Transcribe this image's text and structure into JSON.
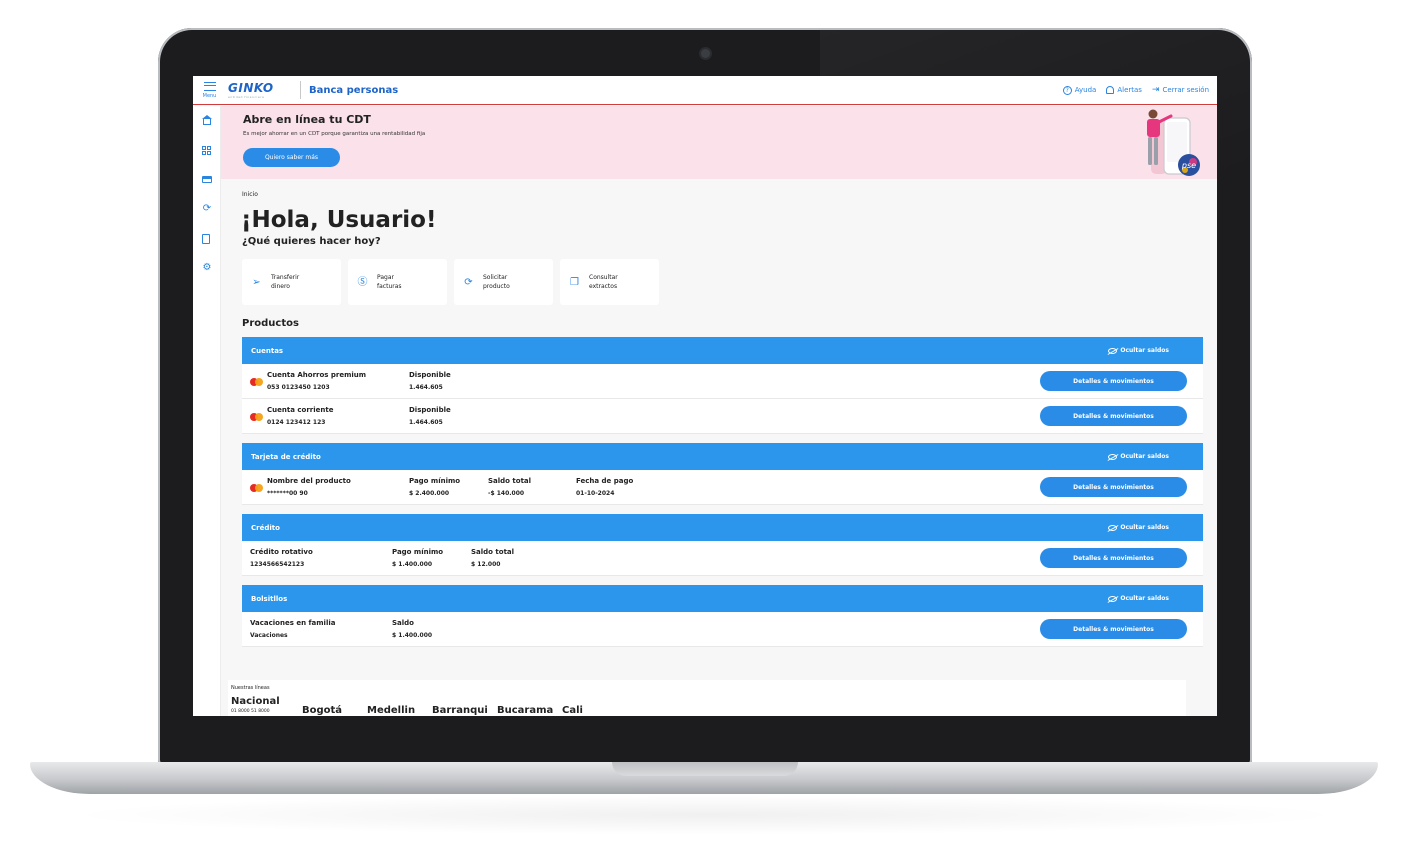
{
  "topbar": {
    "menu_label": "Menu",
    "logo_text": "GINKO",
    "logo_tagline": "entidad financiera",
    "app_title": "Banca personas",
    "help": "Ayuda",
    "alerts": "Alertas",
    "logout": "Cerrar sesión"
  },
  "sidebar": {
    "items": [
      {
        "icon": "home-icon"
      },
      {
        "icon": "dashboard-grid-icon"
      },
      {
        "icon": "credit-card-icon"
      },
      {
        "icon": "exchange-icon"
      },
      {
        "icon": "document-icon"
      },
      {
        "icon": "settings-gear-icon"
      }
    ]
  },
  "banner": {
    "title": "Abre en línea tu CDT",
    "subtitle": "Es mejor ahorrar en un CDT porque garantiza una rentabilidad fija",
    "cta": "Quiero saber más",
    "pse_label": "pse"
  },
  "main": {
    "breadcrumb": "Inicio",
    "greeting": "¡Hola, Usuario!",
    "question": "¿Qué quieres hacer hoy?",
    "quick_actions": [
      {
        "label": "Transferir dinero",
        "icon": "send-icon"
      },
      {
        "label": "Pagar facturas",
        "icon": "dollar-coin-icon"
      },
      {
        "label": "Solicitar producto",
        "icon": "refresh-icon"
      },
      {
        "label": "Consultar extractos",
        "icon": "copy-document-icon"
      }
    ],
    "products_title": "Productos"
  },
  "hide_balances_label": "Ocultar saldos",
  "details_label": "Detalles & movimientos",
  "sections": {
    "cuentas": {
      "title": "Cuentas",
      "rows": [
        {
          "name": "Cuenta Ahorros premium",
          "number": "053 0123450 1203",
          "label1": "Disponible",
          "value1": "1.464.605"
        },
        {
          "name": "Cuenta corriente",
          "number": "0124 123412 123",
          "label1": "Disponible",
          "value1": "1.464.605"
        }
      ]
    },
    "tarjeta": {
      "title": "Tarjeta de crédito",
      "rows": [
        {
          "name": "Nombre del producto",
          "number": "*******00 90",
          "label1": "Pago mínimo",
          "value1": "$ 2.400.000",
          "label2": "Saldo total",
          "value2": "-$ 140.000",
          "label3": "Fecha de pago",
          "value3": "01-10-2024"
        }
      ]
    },
    "credito": {
      "title": "Crédito",
      "rows": [
        {
          "name": "Crédito rotativo",
          "number": "1234566542123",
          "label1": "Pago mínimo",
          "value1": "$ 1.400.000",
          "label2": "Saldo total",
          "value2": "$ 12.000"
        }
      ]
    },
    "bolsillos": {
      "title": "Bolsitllos",
      "rows": [
        {
          "name": "Vacaciones en familia",
          "number": "Vacaciones",
          "label1": "Saldo",
          "value1": "$ 1.400.000"
        }
      ]
    }
  },
  "footer": {
    "heading": "Nuestras líneas",
    "national": "Nacional",
    "national_number": "01 8000 51 8000",
    "cities": [
      "Bogotá",
      "Medellin",
      "Barranqui",
      "Bucarama",
      "Cali"
    ]
  },
  "colors": {
    "primary": "#2b96ec",
    "brand": "#1e64c8",
    "banner_bg": "#fbe1ea",
    "accent_line": "#d23b3b"
  }
}
